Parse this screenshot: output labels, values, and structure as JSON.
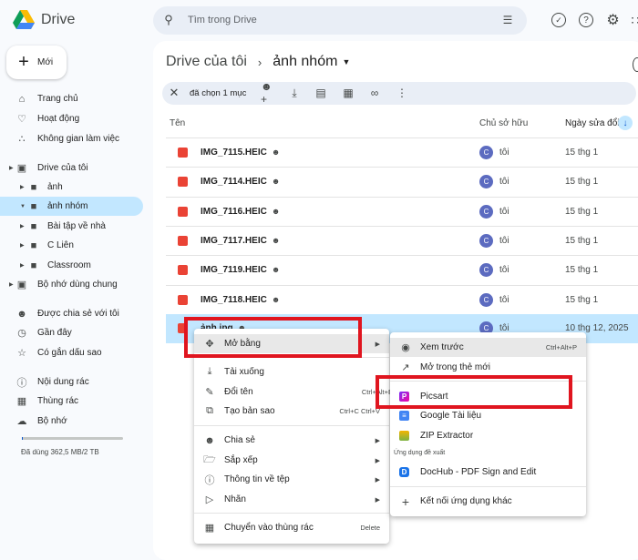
{
  "header": {
    "app_name": "Drive",
    "search_placeholder": "Tìm trong Drive"
  },
  "new_button": "Mới",
  "sidebar": {
    "items": [
      {
        "label": "Trang chủ",
        "icon": "home-icon"
      },
      {
        "label": "Hoạt động",
        "icon": "bell-icon"
      },
      {
        "label": "Không gian làm việc",
        "icon": "workspace-icon"
      },
      {
        "label": "Drive của tôi",
        "icon": "drive-icon"
      },
      {
        "label": "ảnh",
        "icon": "folder-icon"
      },
      {
        "label": "ảnh nhóm",
        "icon": "folder-icon"
      },
      {
        "label": "Bài tập về nhà",
        "icon": "folder-icon"
      },
      {
        "label": "C Liên",
        "icon": "folder-icon"
      },
      {
        "label": "Classroom",
        "icon": "folder-icon"
      },
      {
        "label": "Bộ nhớ dùng chung",
        "icon": "shared-drive-icon"
      },
      {
        "label": "Được chia sẻ với tôi",
        "icon": "people-icon"
      },
      {
        "label": "Gần đây",
        "icon": "clock-icon"
      },
      {
        "label": "Có gắn dấu sao",
        "icon": "star-icon"
      },
      {
        "label": "Nội dung rác",
        "icon": "spam-icon"
      },
      {
        "label": "Thùng rác",
        "icon": "trash-icon"
      },
      {
        "label": "Bộ nhớ",
        "icon": "cloud-icon"
      }
    ],
    "storage_text": "Đã dùng 362,5 MB/2 TB",
    "storage_fraction": 0.0002
  },
  "breadcrumb": {
    "root": "Drive của tôi",
    "current": "ảnh nhóm"
  },
  "selection_bar": {
    "text": "đã chọn 1 mục"
  },
  "table": {
    "columns": [
      "Tên",
      "Chủ sở hữu",
      "Ngày sửa đổi"
    ],
    "rows": [
      {
        "name": "IMG_7115.HEIC",
        "owner": "tôi",
        "date": "15 thg 1"
      },
      {
        "name": "IMG_7114.HEIC",
        "owner": "tôi",
        "date": "15 thg 1"
      },
      {
        "name": "IMG_7116.HEIC",
        "owner": "tôi",
        "date": "15 thg 1"
      },
      {
        "name": "IMG_7117.HEIC",
        "owner": "tôi",
        "date": "15 thg 1"
      },
      {
        "name": "IMG_7119.HEIC",
        "owner": "tôi",
        "date": "15 thg 1"
      },
      {
        "name": "IMG_7118.HEIC",
        "owner": "tôi",
        "date": "15 thg 1"
      },
      {
        "name": "ảnh.jpg",
        "owner": "tôi",
        "date": "10 thg 12, 2025"
      }
    ],
    "avatar_letter": "C"
  },
  "context_menu": {
    "open_with": "Mở bằng",
    "download": "Tải xuống",
    "rename": "Đổi tên",
    "rename_shortcut": "Ctrl+Alt+E",
    "copy": "Tạo bản sao",
    "copy_shortcut": "Ctrl+C Ctrl+V",
    "share": "Chia sẻ",
    "organize": "Sắp xếp",
    "file_info": "Thông tin về tệp",
    "label": "Nhãn",
    "trash": "Chuyển vào thùng rác",
    "trash_shortcut": "Delete"
  },
  "submenu": {
    "preview": "Xem trước",
    "preview_shortcut": "Ctrl+Alt+P",
    "new_tab": "Mở trong thẻ mới",
    "picsart": "Picsart",
    "docs": "Google Tài liệu",
    "zip": "ZIP Extractor",
    "suggested": "Ứng dụng đề xuất",
    "dochub": "DocHub - PDF Sign and Edit",
    "connect": "Kết nối ứng dụng khác"
  },
  "colors": {
    "accent": "#c2e7ff",
    "highlight": "#e0151f"
  }
}
